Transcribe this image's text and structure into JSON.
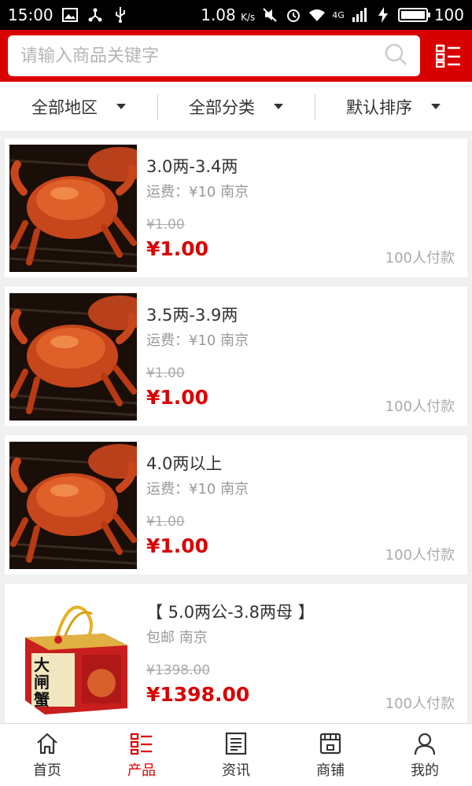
{
  "status_bar": {
    "time": "15:00",
    "speed": "1.08",
    "speed_unit": "K/s",
    "network": "4G",
    "battery": "100",
    "battery_level": 1.0
  },
  "search": {
    "placeholder": "请输入商品关键字"
  },
  "filters": [
    {
      "label": "全部地区"
    },
    {
      "label": "全部分类"
    },
    {
      "label": "默认排序"
    }
  ],
  "products": [
    {
      "title": "3.0两-3.4两",
      "shipping": "运费：¥10 南京",
      "original_price": "¥1.00",
      "price": "¥1.00",
      "paid": "100人付款",
      "image": "crab"
    },
    {
      "title": "3.5两-3.9两",
      "shipping": "运费：¥10 南京",
      "original_price": "¥1.00",
      "price": "¥1.00",
      "paid": "100人付款",
      "image": "crab"
    },
    {
      "title": "4.0两以上",
      "shipping": "运费：¥10 南京",
      "original_price": "¥1.00",
      "price": "¥1.00",
      "paid": "100人付款",
      "image": "crab"
    },
    {
      "title": "【 5.0两公-3.8两母 】",
      "shipping": "包邮 南京",
      "original_price": "¥1398.00",
      "price": "¥1398.00",
      "paid": "100人付款",
      "image": "gift-box",
      "box_text": "大闸蟹"
    }
  ],
  "bottom_nav": [
    {
      "label": "首页",
      "icon": "home-icon"
    },
    {
      "label": "产品",
      "icon": "list-icon",
      "active": true
    },
    {
      "label": "资讯",
      "icon": "news-icon"
    },
    {
      "label": "商铺",
      "icon": "store-icon"
    },
    {
      "label": "我的",
      "icon": "user-icon"
    }
  ],
  "colors": {
    "accent": "#d90000",
    "muted": "#999999"
  }
}
